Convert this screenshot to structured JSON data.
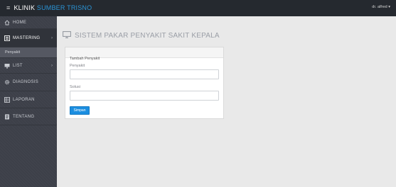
{
  "topbar": {
    "brand_prefix": "KLINIK",
    "brand_suffix": "SUMBER TRISNO",
    "user_label": "dr. alfred ▾",
    "menu_icon": "menu-icon",
    "brand_color": "#2a94d6"
  },
  "sidebar": {
    "items": [
      {
        "label": "HOME",
        "icon": "home-icon"
      },
      {
        "label": "MASTERING",
        "icon": "list-icon",
        "chevron": "›"
      },
      {
        "label": "LIST",
        "icon": "monitor-icon",
        "chevron": "›"
      },
      {
        "label": "DIAGNOSIS",
        "icon": "gear-icon"
      },
      {
        "label": "LAPORAN",
        "icon": "table-icon"
      },
      {
        "label": "TENTANG",
        "icon": "document-icon"
      }
    ],
    "subitem": {
      "label": "Penyakit"
    }
  },
  "page": {
    "title": "SISTEM PAKAR PENYAKIT SAKIT KEPALA",
    "title_icon": "monitor-icon"
  },
  "form": {
    "heading": "Tambah Penyakit",
    "field1_label": "Penyakit",
    "field1_value": "",
    "field2_label": "Solusi",
    "field2_value": "",
    "submit_label": "Simpan",
    "accent": "#1b8ee0"
  }
}
